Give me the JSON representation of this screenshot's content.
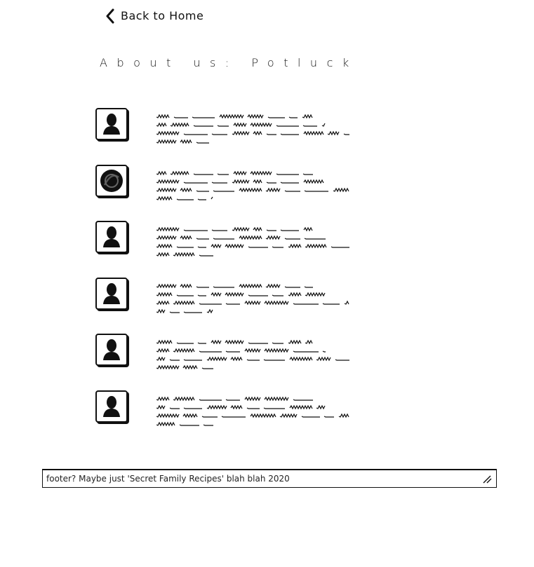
{
  "header": {
    "back_label": "Back to Home",
    "back_icon": "chevron-left-icon"
  },
  "page": {
    "title": "About us: Potluck"
  },
  "members": [
    {
      "avatar": "person-silhouette-icon",
      "bio_lines": 4
    },
    {
      "avatar": "avatar-placeholder-icon",
      "bio_lines": 4
    },
    {
      "avatar": "person-silhouette-icon",
      "bio_lines": 4
    },
    {
      "avatar": "person-silhouette-icon",
      "bio_lines": 4
    },
    {
      "avatar": "person-silhouette-icon",
      "bio_lines": 4
    },
    {
      "avatar": "person-silhouette-icon",
      "bio_lines": 4
    }
  ],
  "footer": {
    "text": "footer? Maybe just 'Secret Family Recipes' blah blah 2020",
    "resize_icon": "resize-handle-icon"
  },
  "colors": {
    "ink": "#111111",
    "background": "#ffffff"
  }
}
